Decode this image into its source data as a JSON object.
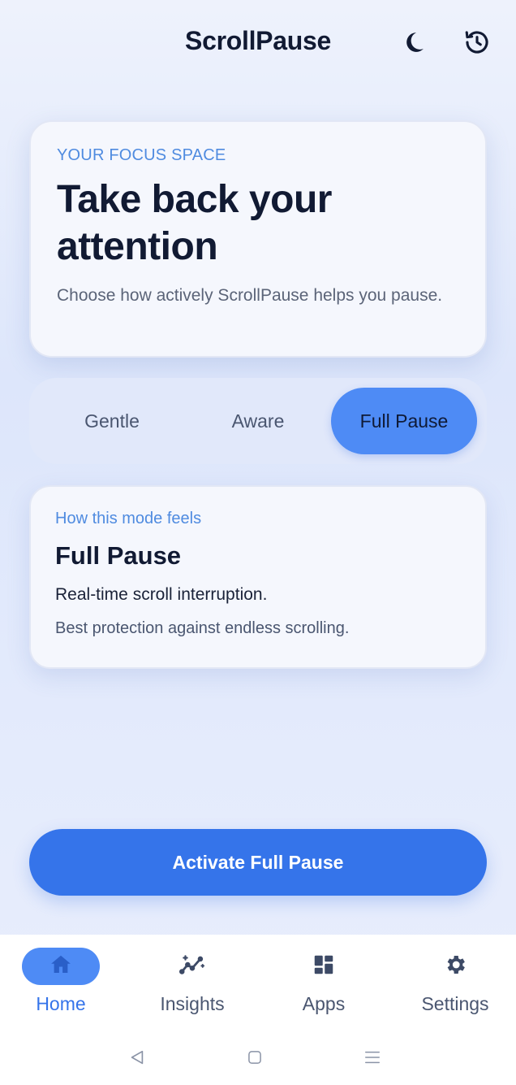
{
  "app": {
    "title": "ScrollPause"
  },
  "header": {
    "icons": [
      "moon-icon",
      "history-icon"
    ]
  },
  "hero": {
    "eyebrow": "YOUR FOCUS SPACE",
    "title": "Take back your attention",
    "subtitle": "Choose how actively ScrollPause helps you pause."
  },
  "modes": {
    "selected": "Full Pause",
    "options": [
      {
        "label": "Gentle"
      },
      {
        "label": "Aware"
      },
      {
        "label": "Full Pause"
      }
    ]
  },
  "mode_card": {
    "eyebrow": "How this mode feels",
    "title": "Full Pause",
    "line1": "Real-time scroll interruption.",
    "line2": "Best protection against endless scrolling."
  },
  "cta": {
    "label": "Activate Full Pause"
  },
  "bottom_nav": {
    "items": [
      {
        "label": "Home",
        "icon": "home-icon",
        "active": true
      },
      {
        "label": "Insights",
        "icon": "insights-icon",
        "active": false
      },
      {
        "label": "Apps",
        "icon": "apps-grid-icon",
        "active": false
      },
      {
        "label": "Settings",
        "icon": "gear-icon",
        "active": false
      }
    ]
  },
  "colors": {
    "accent": "#3574ea",
    "accent_light": "#4e8bf5",
    "eyebrow": "#4f8be0",
    "text_dark": "#111a33"
  }
}
